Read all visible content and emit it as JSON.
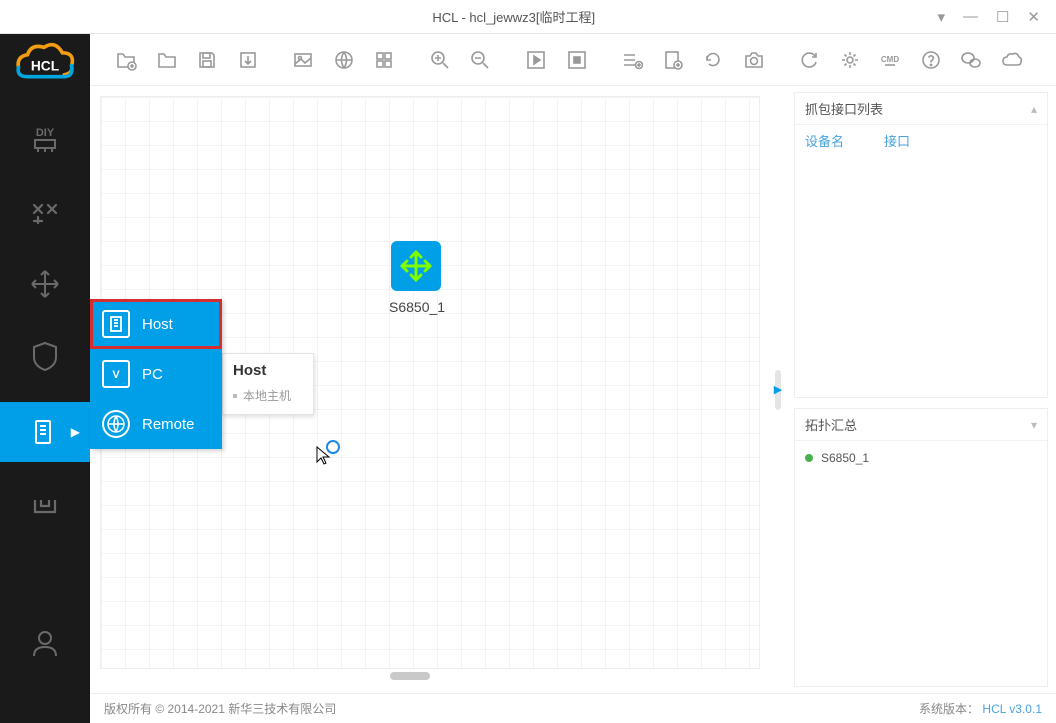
{
  "window": {
    "title": "HCL - hcl_jewwz3[临时工程]"
  },
  "sidebar_labels": {
    "diy": "DIY"
  },
  "submenu": {
    "host": "Host",
    "pc": "PC",
    "remote": "Remote"
  },
  "tooltip": {
    "title": "Host",
    "desc": "本地主机"
  },
  "canvas": {
    "device_label": "S6850_1"
  },
  "right": {
    "capture_panel_title": "抓包接口列表",
    "col_device": "设备名",
    "col_interface": "接口",
    "topology_panel_title": "拓扑汇总",
    "topo_item_1": "S6850_1"
  },
  "status": {
    "copyright": "版权所有 © 2014-2021 新华三技术有限公司",
    "version_label": "系统版本：",
    "version_value": "HCL v3.0.1"
  },
  "colors": {
    "accent": "#009fe8",
    "highlight_border": "#d62e2e"
  }
}
